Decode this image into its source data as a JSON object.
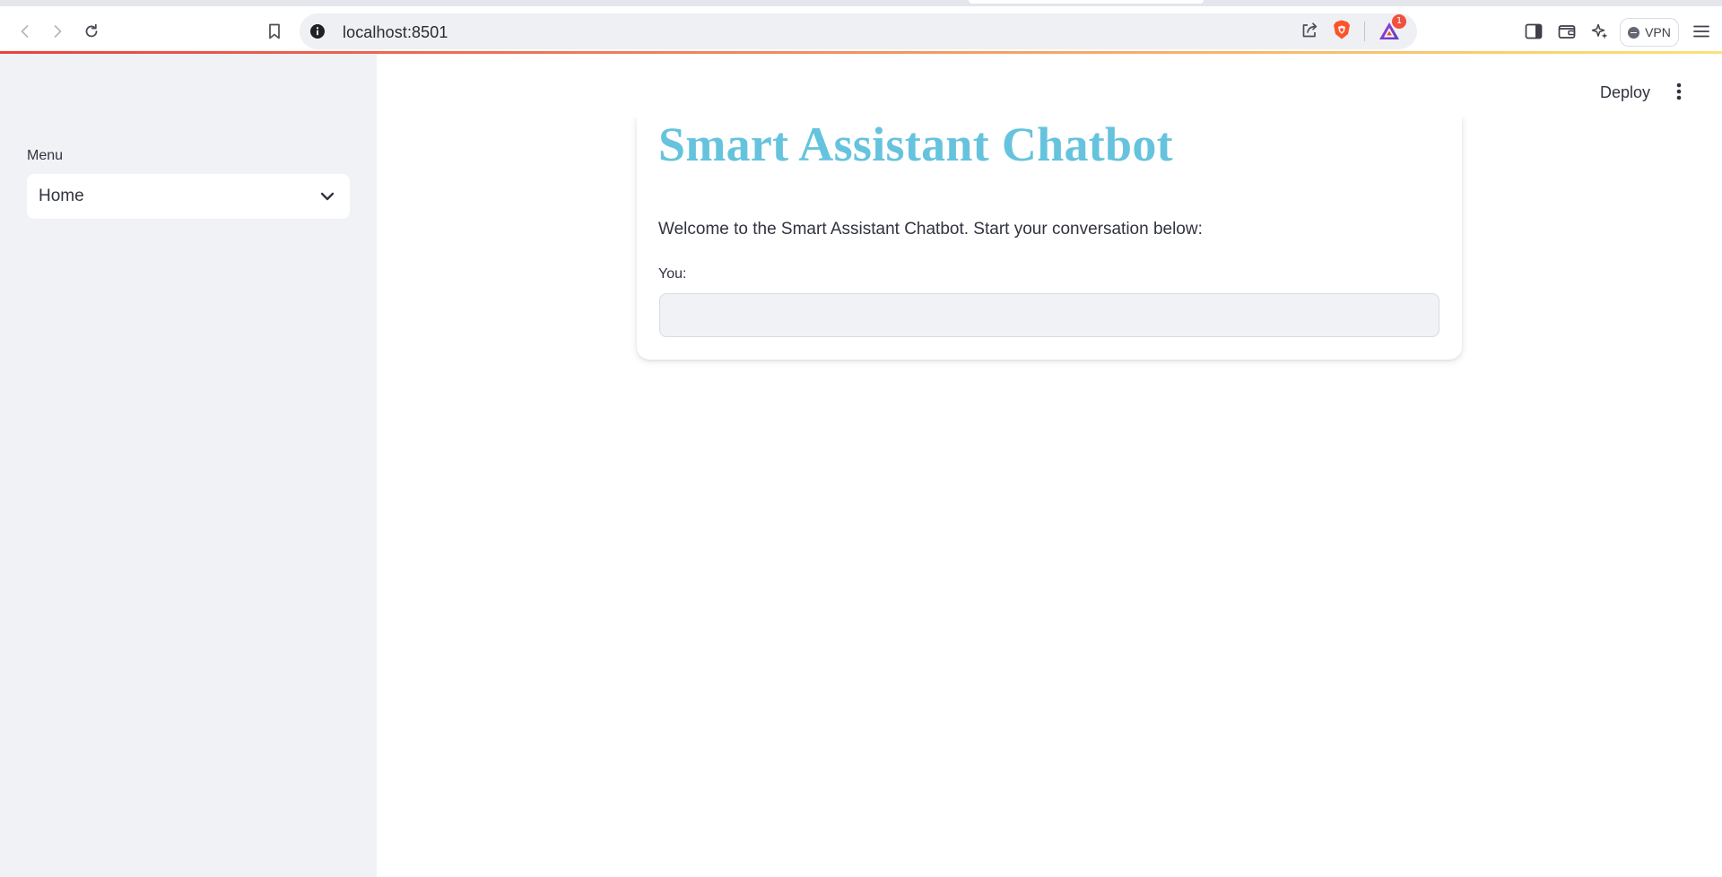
{
  "browser": {
    "url": "localhost:8501",
    "rewards_badge_count": "1",
    "vpn_label": "VPN"
  },
  "sidebar": {
    "menu_label": "Menu",
    "menu_selected": "Home"
  },
  "header": {
    "deploy_label": "Deploy"
  },
  "main": {
    "title": "Smart Assistant Chatbot",
    "welcome_text": "Welcome to the Smart Assistant Chatbot. Start your conversation below:",
    "input_label": "You:",
    "input_value": ""
  },
  "colors": {
    "title_accent": "#66c3dd",
    "sidebar_bg": "#f0f2f6",
    "brave_orange": "#fb542b",
    "rewards_badge": "#f0513e"
  }
}
